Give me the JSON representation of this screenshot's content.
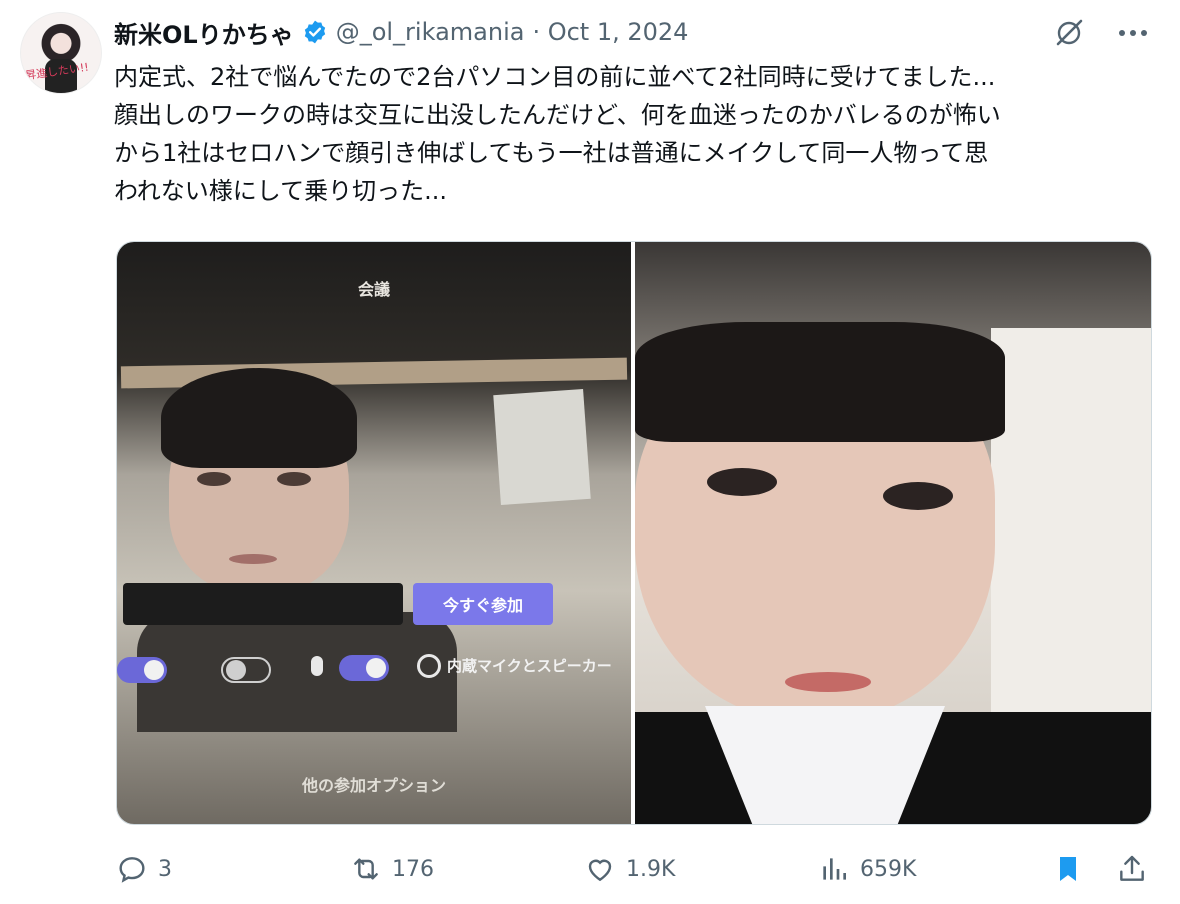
{
  "author": {
    "display_name": "新米OLりかちゃ",
    "handle": "@_ol_rikamania",
    "date": "· Oct 1, 2024",
    "avatar_caption": "昇進したい!!"
  },
  "tweet_text": "内定式、2社で悩んでたので2台パソコン目の前に並べて2社同時に受けてました...\n顔出しのワークの時は交互に出没したんだけど、何を血迷ったのかバレるのが怖い\nから1社はセロハンで顔引き伸ばしてもう一社は普通にメイクして同一人物って思\nわれない様にして乗り切った...",
  "media": {
    "left_photo": {
      "meeting_title": "会議",
      "join_button": "今すぐ参加",
      "audio_setting": "内蔵マイクとスピーカー",
      "other_options": "他の参加オプション"
    }
  },
  "actions": {
    "replies": "3",
    "reposts": "176",
    "likes": "1.9K",
    "views": "659K"
  },
  "colors": {
    "text": "#0f1419",
    "secondary": "#536471",
    "verified": "#1d9bf0",
    "bookmark_active": "#1d9bf0",
    "join_button": "#7b78ea"
  },
  "icons": [
    "verified-badge-icon",
    "grok-icon",
    "more-icon",
    "reply-icon",
    "repost-icon",
    "like-icon",
    "views-icon",
    "bookmark-icon",
    "share-icon"
  ]
}
